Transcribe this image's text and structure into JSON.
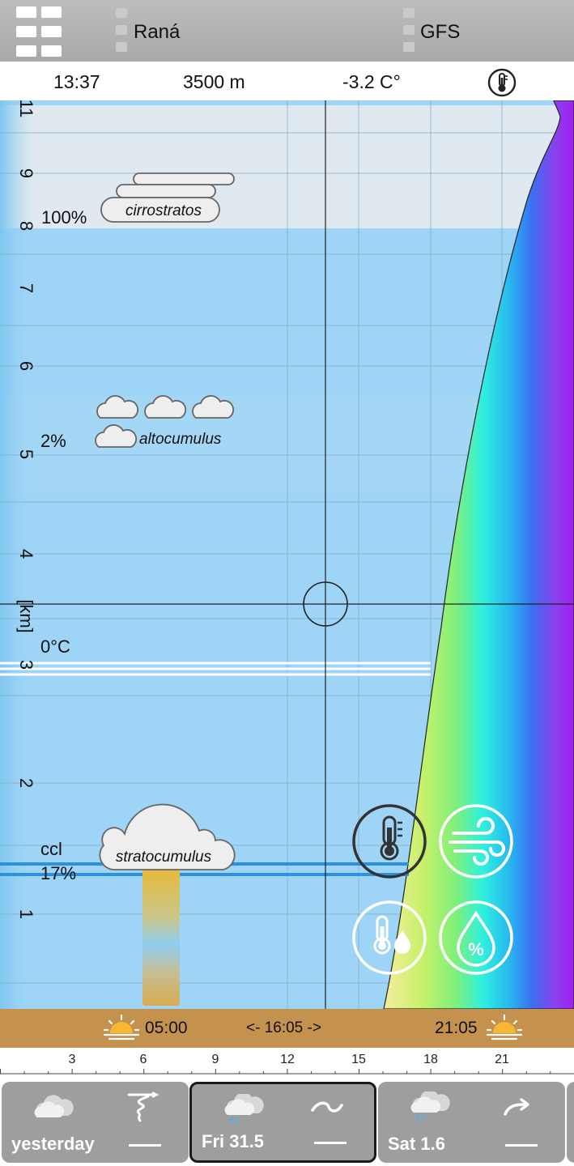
{
  "header": {
    "location": "Raná",
    "model": "GFS"
  },
  "cursor": {
    "time": "13:37",
    "altitude": "3500 m",
    "temperature": "-3.2 C°"
  },
  "chart": {
    "y_axis_unit": "[km]",
    "y_ticks": [
      "1",
      "2",
      "3",
      "4",
      "5",
      "6",
      "7",
      "8",
      "9",
      "11"
    ],
    "layers": {
      "cirrostratus": {
        "name": "cirrostratos",
        "cover": "100%"
      },
      "altocumulus": {
        "name": "altocumulus",
        "cover": "2%"
      },
      "stratocumulus": {
        "name": "stratocumulus",
        "cover": "17%",
        "base_label": "ccl"
      }
    },
    "freezing_level_label": "0°C",
    "colors": {
      "sky": "#9ed4f6",
      "high_cloud_band": "#dfe9ef",
      "ground": "#c4914f",
      "ccl_line": "#2e8fdb"
    },
    "overlay_buttons": [
      "temperature-icon",
      "wind-icon",
      "dew-point-icon",
      "humidity-icon"
    ]
  },
  "sun": {
    "sunrise": "05:00",
    "day_length": "<- 16:05 ->",
    "sunset": "21:05"
  },
  "ruler": {
    "hours": [
      "3",
      "6",
      "9",
      "12",
      "15",
      "18",
      "21"
    ]
  },
  "days": [
    {
      "label": "yesterday",
      "selected": false,
      "weather_icon": "cloudy-icon",
      "wind_icon": "tornado-wind-icon"
    },
    {
      "label": "Fri 31.5",
      "selected": true,
      "weather_icon": "rain-cloud-icon",
      "wind_icon": "wave-wind-icon"
    },
    {
      "label": "Sat 1.6",
      "selected": false,
      "weather_icon": "rain-cloud-icon",
      "wind_icon": "arrow-wind-icon"
    }
  ]
}
